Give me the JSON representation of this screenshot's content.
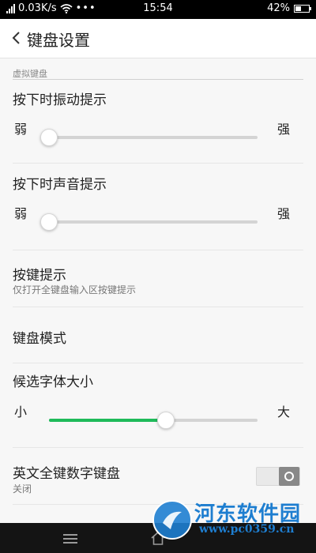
{
  "status_bar": {
    "network_speed": "0.03K/s",
    "time": "15:54",
    "battery": "42%",
    "battery_level": 0.42
  },
  "header": {
    "title": "键盘设置"
  },
  "section": {
    "label": "虚拟键盘"
  },
  "vibration": {
    "title": "按下时振动提示",
    "min_label": "弱",
    "max_label": "强",
    "value": 0.0
  },
  "sound": {
    "title": "按下时声音提示",
    "min_label": "弱",
    "max_label": "强",
    "value": 0.0
  },
  "key_hint": {
    "title": "按键提示",
    "subtitle": "仅打开全键盘输入区按键提示"
  },
  "keyboard_mode": {
    "title": "键盘模式"
  },
  "font_size": {
    "title": "候选字体大小",
    "min_label": "小",
    "max_label": "大",
    "value": 0.56
  },
  "numeric_keyboard": {
    "title": "英文全键数字键盘",
    "status": "关闭",
    "enabled": false
  },
  "colors": {
    "accent": "#1fba5a",
    "watermark": "#1e7ed0"
  },
  "watermark": {
    "brand": "河东软件园",
    "url": "www.pc0359.cn"
  }
}
